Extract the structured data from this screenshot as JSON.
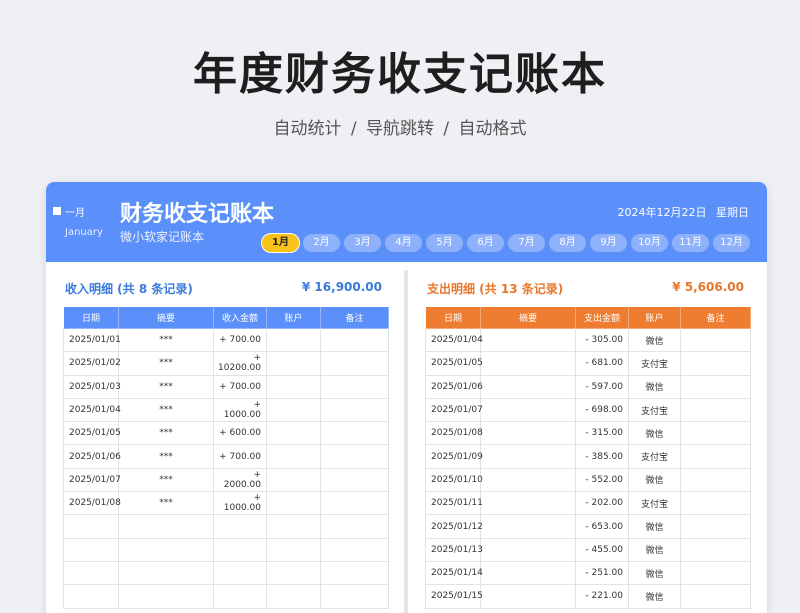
{
  "hero": {
    "title": "年度财务收支记账本",
    "subtitle": "自动统计  /  导航跳转    /  自动格式"
  },
  "header": {
    "month_cn": "一月",
    "month_en": "January",
    "title": "财务收支记账本",
    "subtitle": "微小软家记账本",
    "date": "2024年12月22日  星期日"
  },
  "tabs": [
    "1月",
    "2月",
    "3月",
    "4月",
    "5月",
    "6月",
    "7月",
    "8月",
    "9月",
    "10月",
    "11月",
    "12月"
  ],
  "income": {
    "title": "收入明细 (共 8 条记录)",
    "total": "¥ 16,900.00",
    "columns": [
      "日期",
      "摘要",
      "收入金额",
      "账户",
      "备注"
    ],
    "rows": [
      [
        "2025/01/01",
        "***",
        "+ 700.00",
        "",
        ""
      ],
      [
        "2025/01/02",
        "***",
        "+ 10200.00",
        "",
        ""
      ],
      [
        "2025/01/03",
        "***",
        "+ 700.00",
        "",
        ""
      ],
      [
        "2025/01/04",
        "***",
        "+ 1000.00",
        "",
        ""
      ],
      [
        "2025/01/05",
        "***",
        "+ 600.00",
        "",
        ""
      ],
      [
        "2025/01/06",
        "***",
        "+ 700.00",
        "",
        ""
      ],
      [
        "2025/01/07",
        "***",
        "+ 2000.00",
        "",
        ""
      ],
      [
        "2025/01/08",
        "***",
        "+ 1000.00",
        "",
        ""
      ],
      [
        "",
        "",
        "",
        "",
        ""
      ],
      [
        "",
        "",
        "",
        "",
        ""
      ],
      [
        "",
        "",
        "",
        "",
        ""
      ],
      [
        "",
        "",
        "",
        "",
        ""
      ]
    ]
  },
  "expense": {
    "title": "支出明细 (共 13 条记录)",
    "total": "¥ 5,606.00",
    "columns": [
      "日期",
      "摘要",
      "支出金额",
      "账户",
      "备注"
    ],
    "rows": [
      [
        "2025/01/04",
        "",
        "- 305.00",
        "微信",
        ""
      ],
      [
        "2025/01/05",
        "",
        "- 681.00",
        "支付宝",
        ""
      ],
      [
        "2025/01/06",
        "",
        "- 597.00",
        "微信",
        ""
      ],
      [
        "2025/01/07",
        "",
        "- 698.00",
        "支付宝",
        ""
      ],
      [
        "2025/01/08",
        "",
        "- 315.00",
        "微信",
        ""
      ],
      [
        "2025/01/09",
        "",
        "- 385.00",
        "支付宝",
        ""
      ],
      [
        "2025/01/10",
        "",
        "- 552.00",
        "微信",
        ""
      ],
      [
        "2025/01/11",
        "",
        "- 202.00",
        "支付宝",
        ""
      ],
      [
        "2025/01/12",
        "",
        "- 653.00",
        "微信",
        ""
      ],
      [
        "2025/01/13",
        "",
        "- 455.00",
        "微信",
        ""
      ],
      [
        "2025/01/14",
        "",
        "- 251.00",
        "微信",
        ""
      ],
      [
        "2025/01/15",
        "",
        "- 221.00",
        "微信",
        ""
      ]
    ]
  },
  "colors": {
    "accent_blue": "#5b8ff9",
    "accent_orange": "#ef7d31",
    "active_tab": "#f7c318"
  }
}
